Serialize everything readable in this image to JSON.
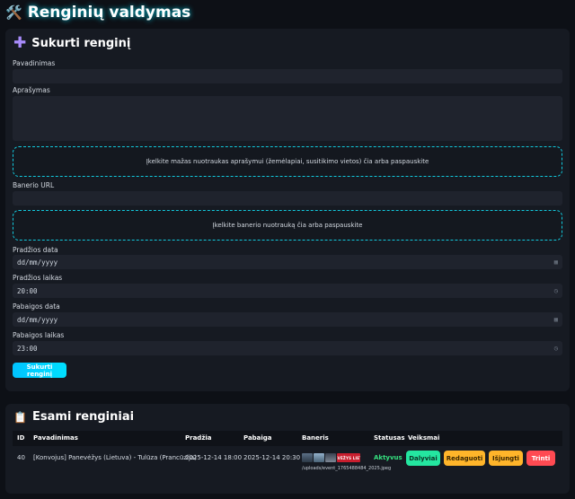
{
  "header": {
    "title": "Renginių valdymas",
    "icon": "🛠️"
  },
  "create": {
    "title": "Sukurti renginį",
    "icon": "plus-icon",
    "name_label": "Pavadinimas",
    "name_value": "",
    "desc_label": "Aprašymas",
    "desc_value": "",
    "small_images_dropzone": "Įkelkite mažas nuotraukas aprašymui (žemėlapiai, susitikimo vietos) čia arba paspauskite",
    "banner_url_label": "Banerio URL",
    "banner_url_value": "",
    "banner_dropzone": "Įkelkite banerio nuotrauką čia arba paspauskite",
    "start_date_label": "Pradžios data",
    "start_date_value": "dd/mm/yyyy",
    "start_time_label": "Pradžios laikas",
    "start_time_value": "20:00",
    "end_date_label": "Pabaigos data",
    "end_date_value": "dd/mm/yyyy",
    "end_time_label": "Pabaigos laikas",
    "end_time_value": "23:00",
    "submit_label": "Sukurti renginį"
  },
  "list": {
    "title": "Esami renginiai",
    "icon": "📋",
    "columns": [
      "ID",
      "Pavadinimas",
      "Pradžia",
      "Pabaiga",
      "Baneris",
      "Statusas",
      "Veiksmai"
    ],
    "rows": [
      {
        "id": "40",
        "name": "[Konvojus] Panevėžys (Lietuva) - Tulūza (Prancūzija)",
        "start": "2025-12-14 18:00",
        "end": "2025-12-14 20:30",
        "banner_badge": "PANEVĖŽYS LIETUVA",
        "banner_path": "/uploads/event_1765488484_2025.jpeg",
        "status": "Aktyvus",
        "actions": {
          "share": "Dalyviai",
          "edit": "Redaguoti",
          "disable": "Išjungti",
          "delete": "Trinti"
        }
      }
    ]
  },
  "colors": {
    "accent": "#00e0ff",
    "background": "#0d1016",
    "panel": "#161a22",
    "success": "#35e07f",
    "warning": "#ffb52a",
    "danger": "#ff4a52"
  }
}
